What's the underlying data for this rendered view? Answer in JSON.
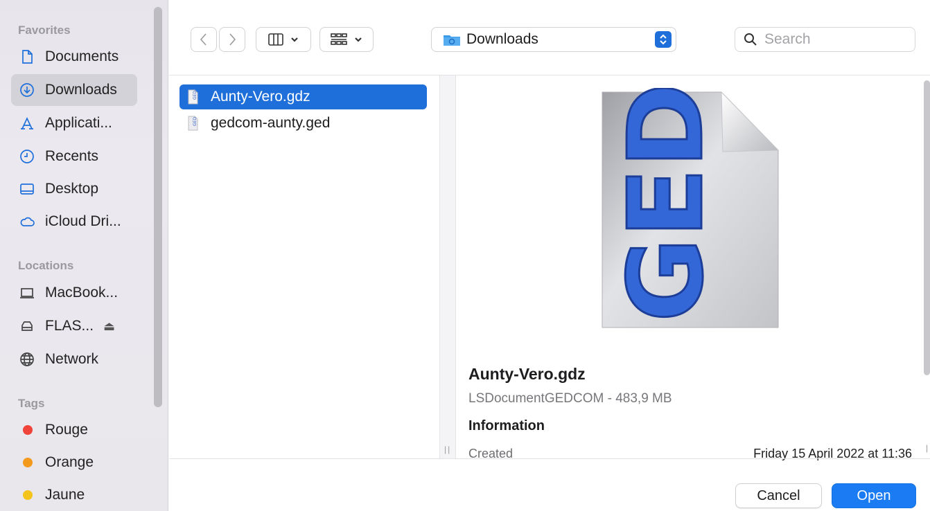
{
  "sidebar": {
    "sections": {
      "favorites": "Favorites",
      "locations": "Locations",
      "tags": "Tags"
    },
    "favorites": [
      {
        "label": "Documents",
        "icon": "document-icon"
      },
      {
        "label": "Downloads",
        "icon": "download-circle-icon",
        "active": true
      },
      {
        "label": "Applicati...",
        "icon": "applications-icon"
      },
      {
        "label": "Recents",
        "icon": "clock-icon"
      },
      {
        "label": "Desktop",
        "icon": "desktop-icon"
      },
      {
        "label": "iCloud Dri...",
        "icon": "cloud-icon"
      }
    ],
    "locations": [
      {
        "label": "MacBook...",
        "icon": "laptop-icon"
      },
      {
        "label": "FLAS...",
        "icon": "external-drive-icon",
        "eject": "⏏"
      },
      {
        "label": "Network",
        "icon": "globe-icon"
      }
    ],
    "tags": [
      {
        "label": "Rouge",
        "color": "#f0433a"
      },
      {
        "label": "Orange",
        "color": "#f39a1c"
      },
      {
        "label": "Jaune",
        "color": "#f3c51c"
      }
    ]
  },
  "toolbar": {
    "location": "Downloads",
    "search_placeholder": "Search"
  },
  "files": [
    {
      "name": "Aunty-Vero.gdz",
      "selected": true
    },
    {
      "name": "gedcom-aunty.ged",
      "selected": false
    }
  ],
  "preview": {
    "icon_text": "GED",
    "name": "Aunty-Vero.gdz",
    "kind_size": "LSDocumentGEDCOM - 483,9 MB",
    "info_heading": "Information",
    "created_label": "Created",
    "created_value": "Friday 15 April 2022 at 11:36"
  },
  "buttons": {
    "cancel": "Cancel",
    "open": "Open"
  },
  "colors": {
    "accent": "#1f6fdb",
    "open_button": "#1a7bf2",
    "sidebar_bg": "#e8e6ec"
  }
}
